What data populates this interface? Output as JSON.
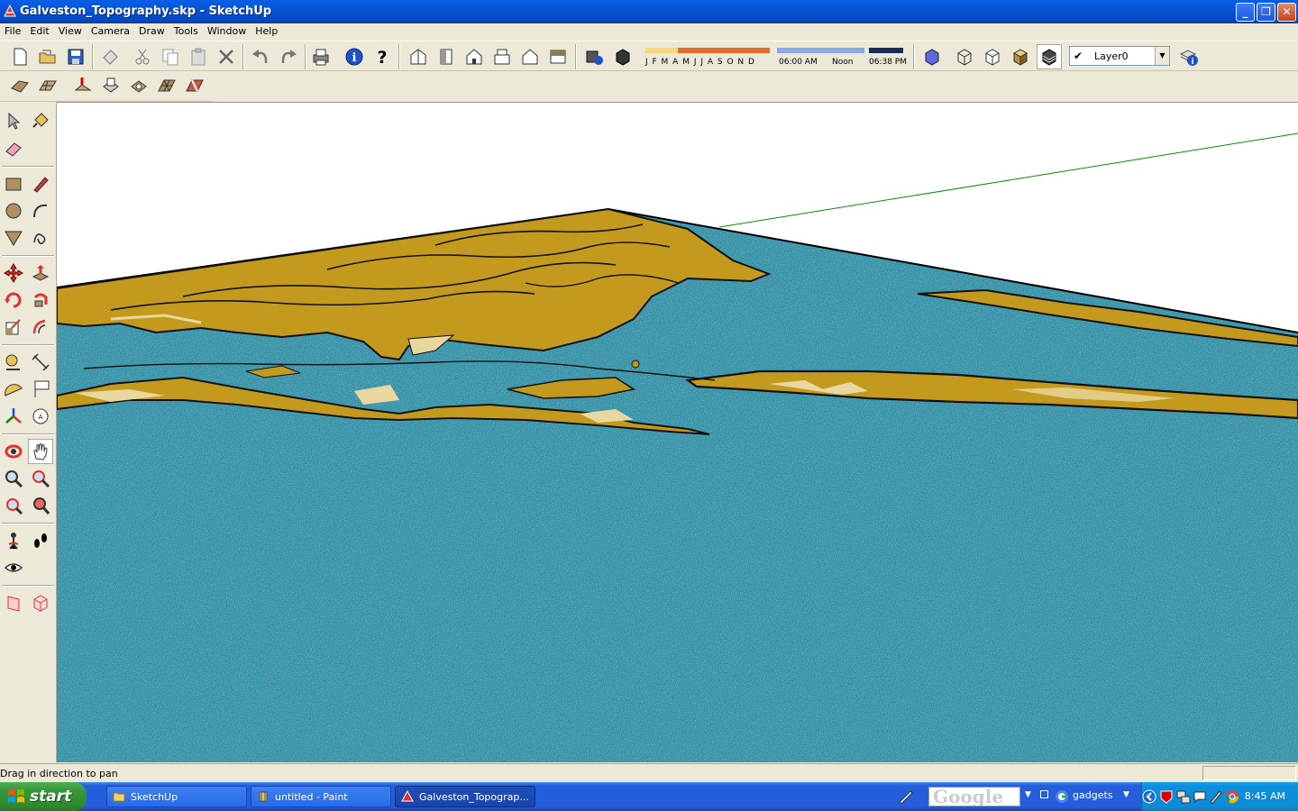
{
  "window": {
    "title": "Galveston_Topography.skp - SketchUp",
    "minimize": "_",
    "restore": "❐",
    "close": "✕"
  },
  "menu": [
    "File",
    "Edit",
    "View",
    "Camera",
    "Draw",
    "Tools",
    "Window",
    "Help"
  ],
  "toolbar": {
    "shadow_months": "J F M A M J J A S O N D",
    "time_start": "06:00 AM",
    "time_noon": "Noon",
    "time_end": "06:38 PM",
    "layer_value": "Layer0",
    "layer_checked": "✔",
    "dropdown_arrow": "▼"
  },
  "status": {
    "text": "Drag in direction to pan"
  },
  "taskbar": {
    "start_label": "start",
    "tasks": [
      {
        "label": "SketchUp",
        "icon": "folder-icon"
      },
      {
        "label": "untitled - Paint",
        "icon": "paint-icon"
      },
      {
        "label": "Galveston_Topograp...",
        "icon": "sketchup-icon"
      }
    ],
    "search_logo": "Google",
    "gadgets_label": "gadgets",
    "clock": "8:45 AM"
  },
  "colors": {
    "water": "#2a8aa0",
    "land": "#c39a1e",
    "land_light": "#e8d8a0",
    "axis_green": "#0a8a0a",
    "title_blue": "#0754d6",
    "taskbar_blue": "#245edb"
  }
}
